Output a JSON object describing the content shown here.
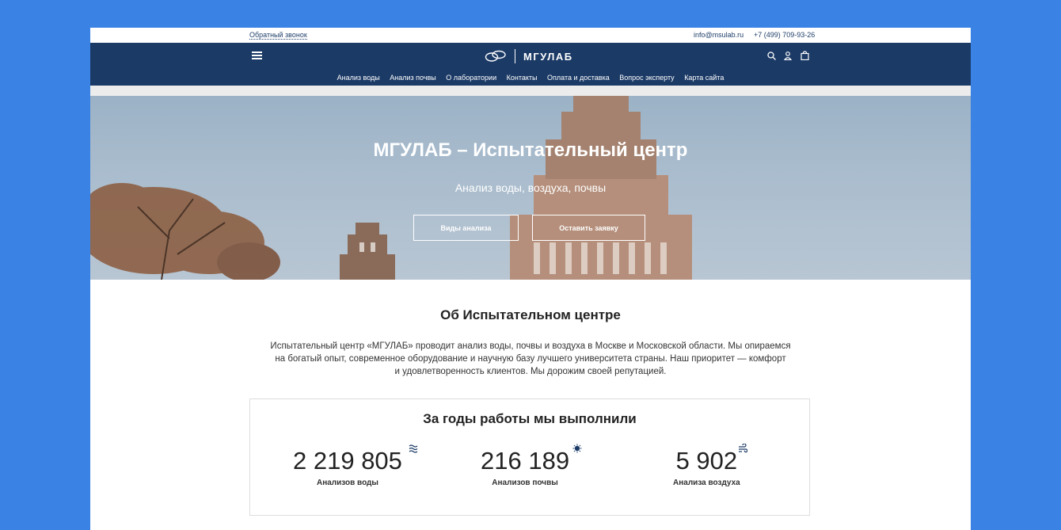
{
  "topbar": {
    "callback": "Обратный звонок",
    "email": "info@msulab.ru",
    "phone": "+7 (499) 709-93-26"
  },
  "header": {
    "logo_text": "МГУЛАБ",
    "menu": [
      "Анализ воды",
      "Анализ почвы",
      "О лаборатории",
      "Контакты",
      "Оплата и доставка",
      "Вопрос эксперту",
      "Карта сайта"
    ],
    "icons": [
      "menu-icon",
      "search-icon",
      "user-icon",
      "cart-icon"
    ]
  },
  "hero": {
    "title": "МГУЛАБ – Испытательный центр",
    "subtitle": "Анализ воды, воздуха, почвы",
    "btn_types": "Виды анализа",
    "btn_request": "Оставить заявку"
  },
  "about": {
    "title": "Об Испытательном центре",
    "text_lines": [
      "Испытательный центр «МГУЛАБ» проводит анализ воды, почвы и воздуха в Москве и Московской области. Мы опираемся",
      "на богатый опыт, современное оборудование и научную базу лучшего университета страны. Наш приоритет — комфорт",
      "и удовлетворенность клиентов. Мы дорожим своей репутацией."
    ]
  },
  "stats": {
    "title": "За годы работы мы выполнили",
    "items": [
      {
        "value": "2 219 805",
        "label": "Анализов воды",
        "icon": "water-waves-icon"
      },
      {
        "value": "216 189",
        "label": "Анализов почвы",
        "icon": "soil-icon"
      },
      {
        "value": "5 902",
        "label": "Анализа воздуха",
        "icon": "wind-icon"
      }
    ]
  },
  "colors": {
    "navbar": "#1b3a66",
    "background": "#3a82e4"
  }
}
